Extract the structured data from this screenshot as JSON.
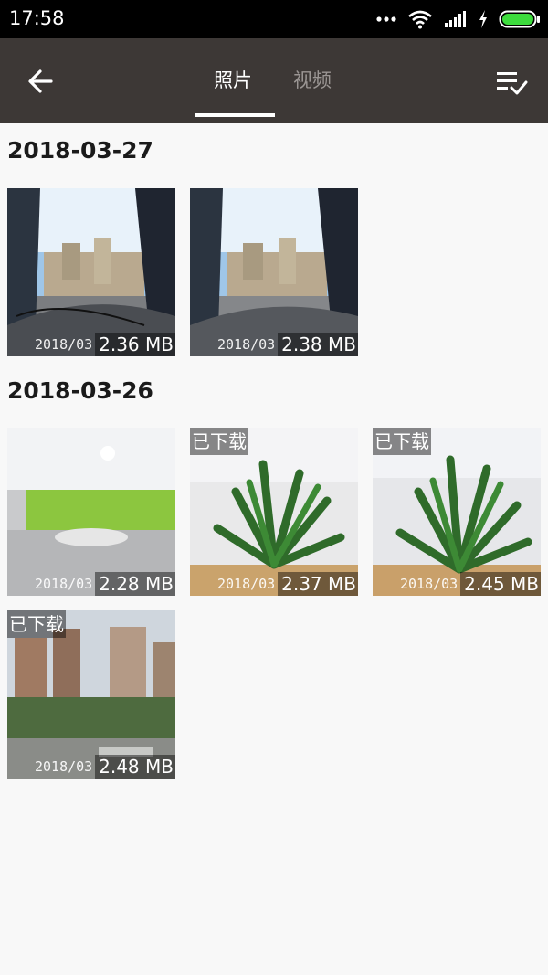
{
  "status_bar": {
    "time": "17:58",
    "icons": [
      "more-dots-icon",
      "wifi-icon",
      "signal-icon",
      "charging-icon",
      "battery-icon"
    ]
  },
  "app_bar": {
    "back_icon": "arrow-left-icon",
    "tabs": [
      {
        "label": "照片",
        "active": true
      },
      {
        "label": "视频",
        "active": false
      }
    ],
    "select_icon": "multi-select-check-icon"
  },
  "sections": [
    {
      "date": "2018-03-27",
      "items": [
        {
          "name_text": "2018/03",
          "size": "2.36 MB",
          "badge": ""
        },
        {
          "name_text": "2018/03",
          "size": "2.38 MB",
          "badge": ""
        }
      ]
    },
    {
      "date": "2018-03-26",
      "items": [
        {
          "name_text": "2018/03",
          "size": "2.28 MB",
          "badge": ""
        },
        {
          "name_text": "2018/03",
          "size": "2.37 MB",
          "badge": "已下载"
        },
        {
          "name_text": "2018/03",
          "size": "2.45 MB",
          "badge": "已下载"
        },
        {
          "name_text": "2018/03",
          "size": "2.48 MB",
          "badge": "已下载"
        }
      ]
    }
  ],
  "colors": {
    "status_bar_bg": "#000000",
    "app_bar_bg": "#3d3836",
    "tab_active": "#ffffff",
    "tab_inactive": "#9a9593",
    "page_bg": "#f8f8f8"
  }
}
